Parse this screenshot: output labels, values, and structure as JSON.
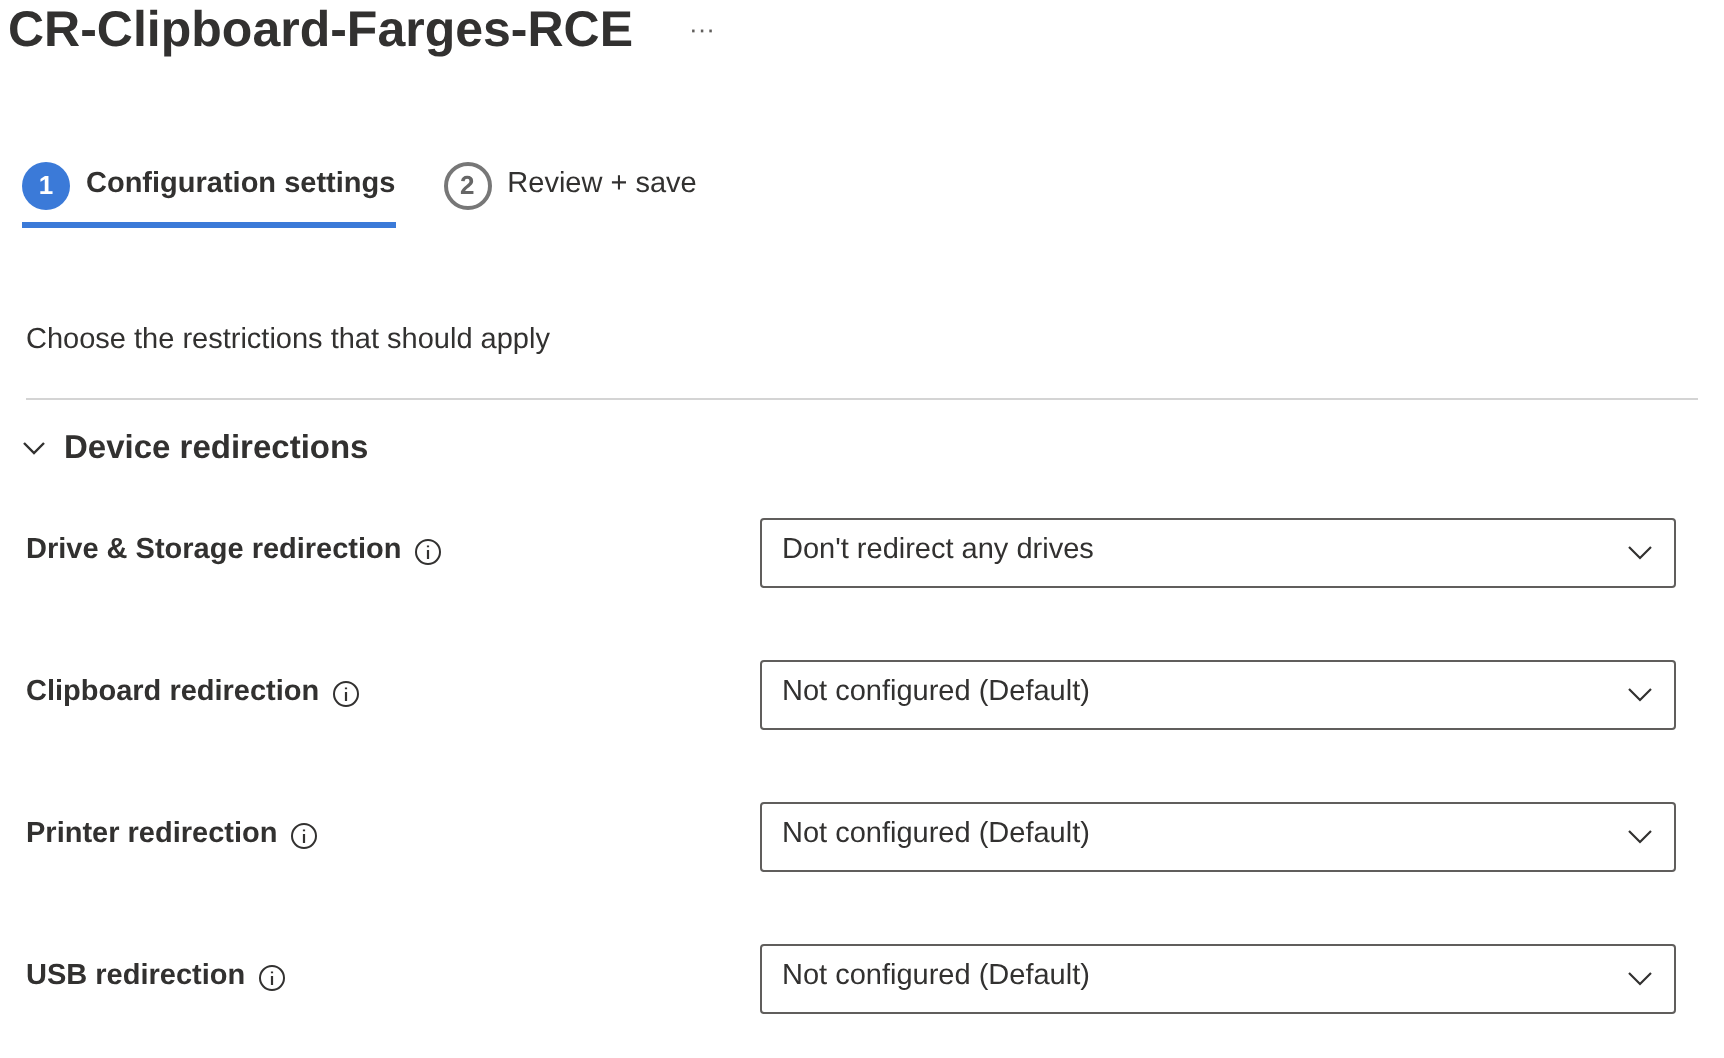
{
  "title": "CR-Clipboard-Farges-RCE",
  "more": "···",
  "steps": [
    {
      "number": "1",
      "label": "Configuration settings",
      "selected": true
    },
    {
      "number": "2",
      "label": "Review + save",
      "selected": false
    }
  ],
  "intro": "Choose the restrictions that should apply",
  "section": {
    "title": "Device redirections",
    "expanded": true,
    "settings": [
      {
        "label": "Drive & Storage redirection",
        "value": "Don't redirect any drives"
      },
      {
        "label": "Clipboard redirection",
        "value": "Not configured (Default)"
      },
      {
        "label": "Printer redirection",
        "value": "Not configured (Default)"
      },
      {
        "label": "USB redirection",
        "value": "Not configured (Default)"
      }
    ]
  }
}
